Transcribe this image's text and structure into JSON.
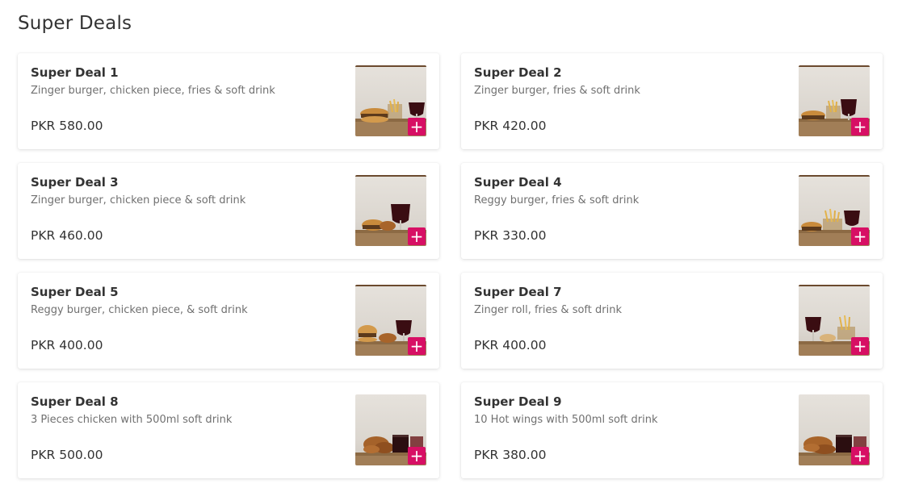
{
  "section": {
    "title": "Super Deals"
  },
  "deals": [
    {
      "name": "Super Deal 1",
      "description": "Zinger burger, chicken piece, fries & soft drink",
      "price": "PKR 580.00",
      "image": "burger-fries-drink-photo"
    },
    {
      "name": "Super Deal 2",
      "description": "Zinger burger, fries & soft drink",
      "price": "PKR 420.00",
      "image": "burger-fries-drink-photo"
    },
    {
      "name": "Super Deal 3",
      "description": "Zinger burger, chicken piece & soft drink",
      "price": "PKR 460.00",
      "image": "burger-chicken-drink-photo"
    },
    {
      "name": "Super Deal 4",
      "description": "Reggy burger, fries & soft drink",
      "price": "PKR 330.00",
      "image": "burger-fries-drink-photo"
    },
    {
      "name": "Super Deal 5",
      "description": "Reggy burger, chicken piece, & soft drink",
      "price": "PKR 400.00",
      "image": "burger-chicken-drink-photo"
    },
    {
      "name": "Super Deal 7",
      "description": "Zinger roll, fries & soft drink",
      "price": "PKR 400.00",
      "image": "roll-fries-drink-photo"
    },
    {
      "name": "Super Deal 8",
      "description": "3 Pieces chicken with 500ml soft drink",
      "price": "PKR 500.00",
      "image": "fried-chicken-drink-photo"
    },
    {
      "name": "Super Deal 9",
      "description": "10 Hot wings with 500ml soft drink",
      "price": "PKR 380.00",
      "image": "hot-wings-drink-photo"
    }
  ],
  "add_button": {
    "label": "+",
    "icon": "plus-icon"
  },
  "colors": {
    "accent": "#d70f64",
    "text": "#333333",
    "muted": "#707070"
  }
}
